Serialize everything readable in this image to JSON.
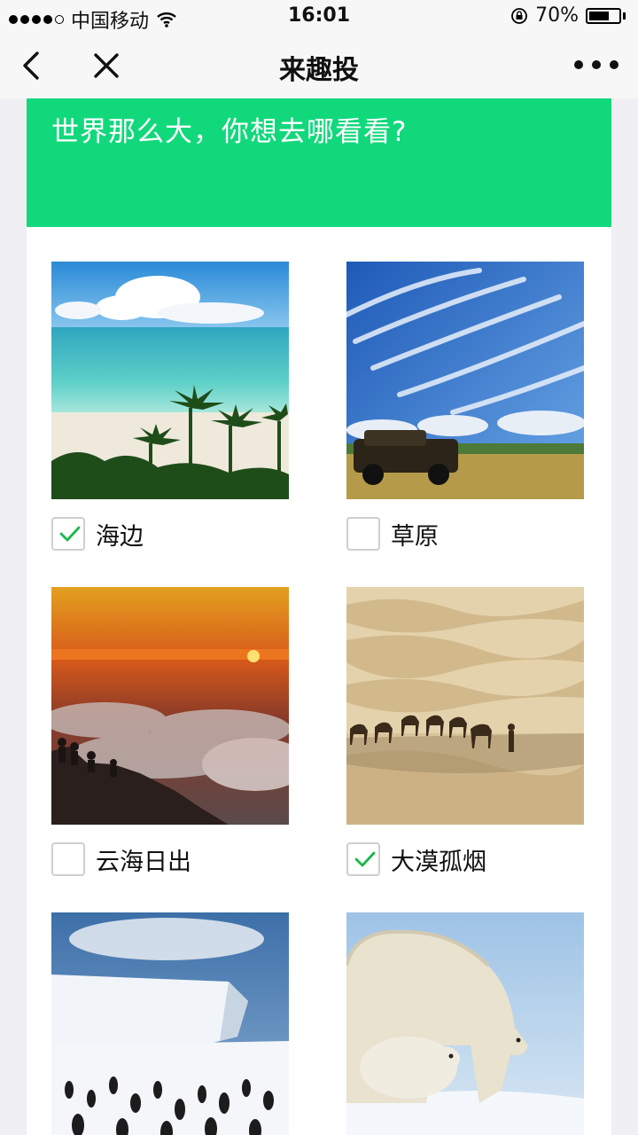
{
  "status_bar": {
    "carrier": "中国移动",
    "time": "16:01",
    "battery_percent_text": "70%",
    "battery_level": 0.7
  },
  "nav": {
    "title": "来趣投",
    "back_icon": "chevron-left-icon",
    "close_icon": "close-icon",
    "more_icon": "more-dots-icon"
  },
  "survey": {
    "question": "世界那么大，你想去哪看看?",
    "accent_color": "#12d87c",
    "options": [
      {
        "label": "海边",
        "checked": true
      },
      {
        "label": "草原",
        "checked": false
      },
      {
        "label": "云海日出",
        "checked": false
      },
      {
        "label": "大漠孤烟",
        "checked": true
      },
      {
        "label": "",
        "checked": false
      },
      {
        "label": "",
        "checked": false
      }
    ]
  }
}
